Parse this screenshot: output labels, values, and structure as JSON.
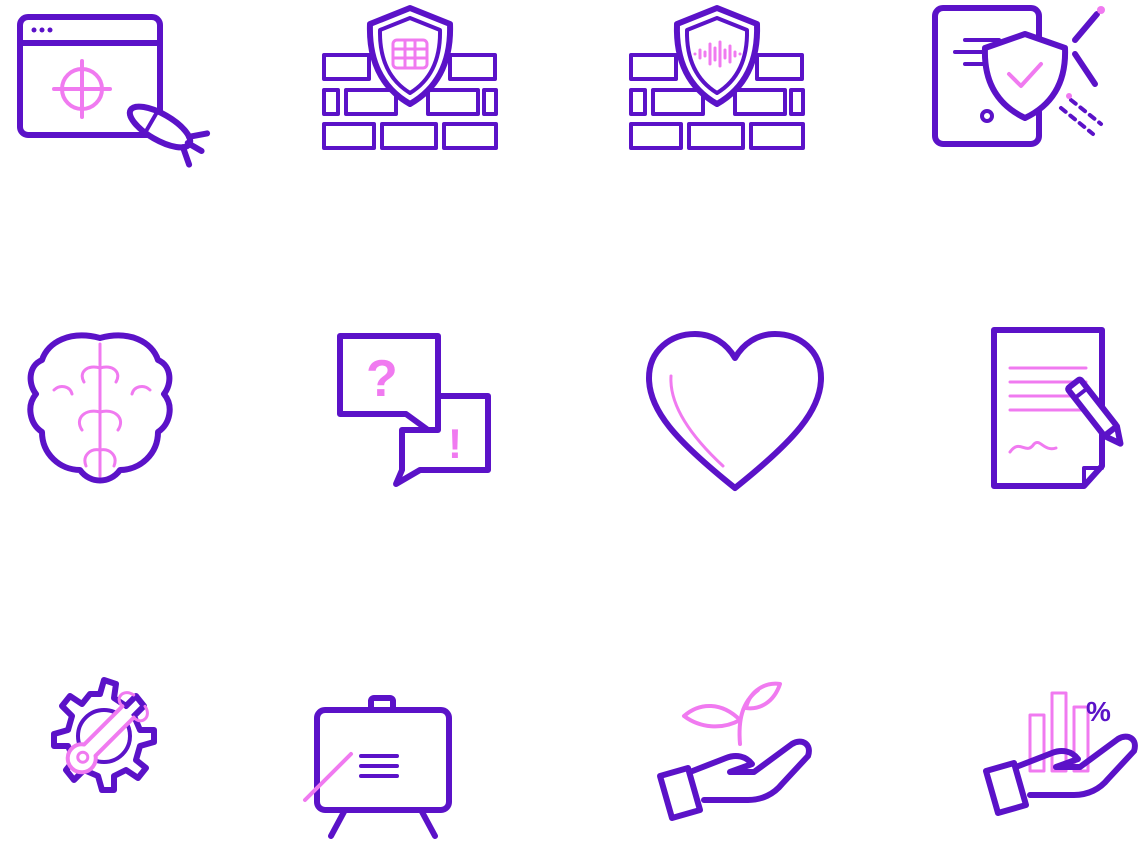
{
  "colors": {
    "primary": "#5b12c8",
    "accent": "#f07af0",
    "background": "#ffffff"
  },
  "icons": [
    {
      "name": "web-attack-target-icon"
    },
    {
      "name": "firewall-shield-icon"
    },
    {
      "name": "firewall-shield-audio-icon"
    },
    {
      "name": "document-security-shield-icon"
    },
    {
      "name": "brain-icon"
    },
    {
      "name": "question-answer-bubbles-icon"
    },
    {
      "name": "heart-icon"
    },
    {
      "name": "signed-contract-icon"
    },
    {
      "name": "gear-wrench-icon"
    },
    {
      "name": "presentation-easel-icon"
    },
    {
      "name": "hand-plant-icon"
    },
    {
      "name": "hand-chart-percent-icon"
    }
  ],
  "glyphs": {
    "question": "?",
    "exclamation": "!",
    "percent": "%"
  }
}
